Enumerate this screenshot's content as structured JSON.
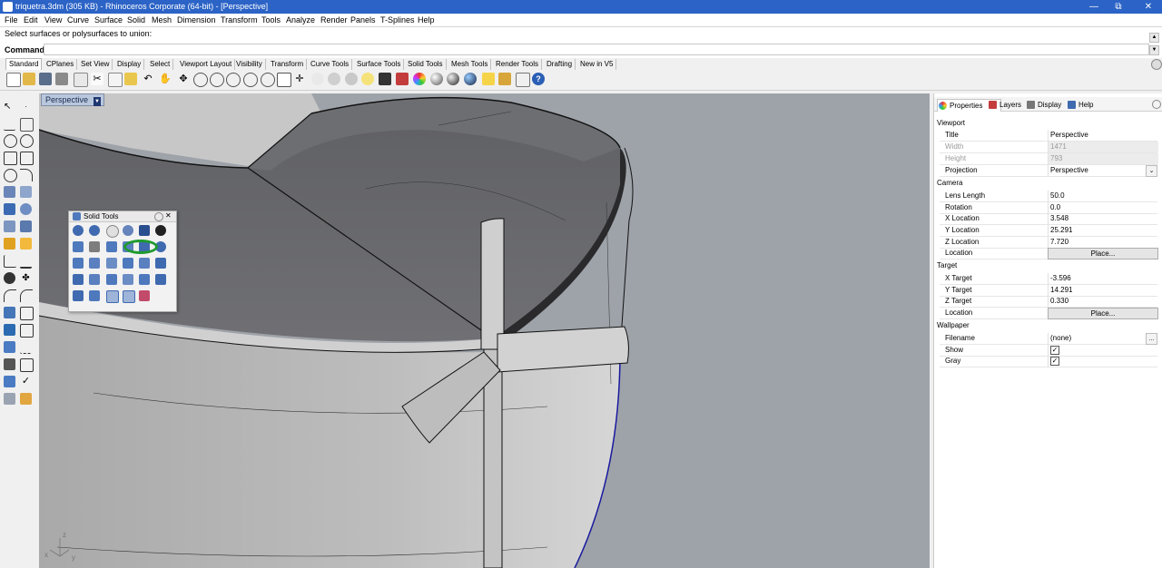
{
  "window": {
    "title": "triquetra.3dm (305 KB) - Rhinoceros Corporate (64-bit) - [Perspective]",
    "minimize": "—",
    "maximize": "⧉",
    "close": "✕"
  },
  "menu": [
    "File",
    "Edit",
    "View",
    "Curve",
    "Surface",
    "Solid",
    "Mesh",
    "Dimension",
    "Transform",
    "Tools",
    "Analyze",
    "Render",
    "Panels",
    "T-Splines",
    "Help"
  ],
  "command": {
    "history": "Select surfaces or polysurfaces to union:",
    "label": "Command:",
    "value": ""
  },
  "toolbar_tabs": [
    "Standard",
    "CPlanes",
    "Set View",
    "Display",
    "Select",
    "Viewport Layout",
    "Visibility",
    "Transform",
    "Curve Tools",
    "Surface Tools",
    "Solid Tools",
    "Mesh Tools",
    "Render Tools",
    "Drafting",
    "New in V5"
  ],
  "active_toolbar_tab": "Standard",
  "viewport": {
    "label": "Perspective",
    "axes": {
      "x": "x",
      "y": "y",
      "z": "z"
    }
  },
  "solid_tools_panel": {
    "title": "Solid Tools"
  },
  "panel_tabs": {
    "properties": "Properties",
    "layers": "Layers",
    "display": "Display",
    "help": "Help"
  },
  "properties": {
    "viewport_header": "Viewport",
    "title_label": "Title",
    "title_value": "Perspective",
    "width_label": "Width",
    "width_value": "1471",
    "height_label": "Height",
    "height_value": "793",
    "projection_label": "Projection",
    "projection_value": "Perspective",
    "camera_header": "Camera",
    "lens_label": "Lens Length",
    "lens_value": "50.0",
    "rotation_label": "Rotation",
    "rotation_value": "0.0",
    "xloc_label": "X Location",
    "xloc_value": "3.548",
    "yloc_label": "Y Location",
    "yloc_value": "25.291",
    "zloc_label": "Z Location",
    "zloc_value": "7.720",
    "location_label": "Location",
    "place_button": "Place...",
    "target_header": "Target",
    "xt_label": "X Target",
    "xt_value": "-3.596",
    "yt_label": "Y Target",
    "yt_value": "14.291",
    "zt_label": "Z Target",
    "zt_value": "0.330",
    "target_location_label": "Location",
    "target_place_button": "Place...",
    "wallpaper_header": "Wallpaper",
    "filename_label": "Filename",
    "filename_value": "(none)",
    "browse_button": "...",
    "show_label": "Show",
    "show_checked": "✓",
    "gray_label": "Gray",
    "gray_checked": "✓"
  }
}
